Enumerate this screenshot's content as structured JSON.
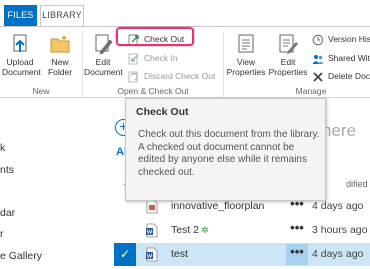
{
  "tabs": {
    "files": "FILES",
    "library": "LIBRARY"
  },
  "ribbon": {
    "new_group": {
      "label": "New",
      "upload_line1": "Upload",
      "upload_line2": "Document",
      "new_folder_line1": "New",
      "new_folder_line2": "Folder"
    },
    "open_group": {
      "label": "Open & Check Out",
      "edit_line1": "Edit",
      "edit_line2": "Document",
      "check_out": "Check Out",
      "check_in": "Check In",
      "discard": "Discard Check Out"
    },
    "manage_group": {
      "label": "Manage",
      "view_line1": "View",
      "view_line2": "Properties",
      "editp_line1": "Edit",
      "editp_line2": "Properties",
      "version_history": "Version His",
      "shared_with": "Shared Wit",
      "delete_doc": "Delete Doc"
    }
  },
  "nav": [
    "k",
    "nts",
    "dar",
    "r",
    "e Gallery"
  ],
  "main": {
    "add_icon": "+",
    "all_label": "Al",
    "search_text": "here",
    "chevron": "⌄",
    "modified_header": "dified"
  },
  "rows": [
    {
      "name": "innovative_floorplan",
      "modified": "4 days ago",
      "icon": "file-icon"
    },
    {
      "name": "Test 2",
      "badge": "✲",
      "modified": "3 hours ago",
      "icon": "word-doc-icon"
    },
    {
      "name": "test",
      "modified": "4 days ago",
      "icon": "word-doc-icon",
      "selected": true
    }
  ],
  "ellipsis": "•••",
  "tooltip": {
    "title": "Check Out",
    "line1": "Check out this document from the library.",
    "line2": "A checked out document cannot be edited by anyone else while it remains checked out."
  },
  "colors": {
    "accent": "#0072c6",
    "highlight": "#e2356d",
    "selected_row": "#cde6f7"
  }
}
